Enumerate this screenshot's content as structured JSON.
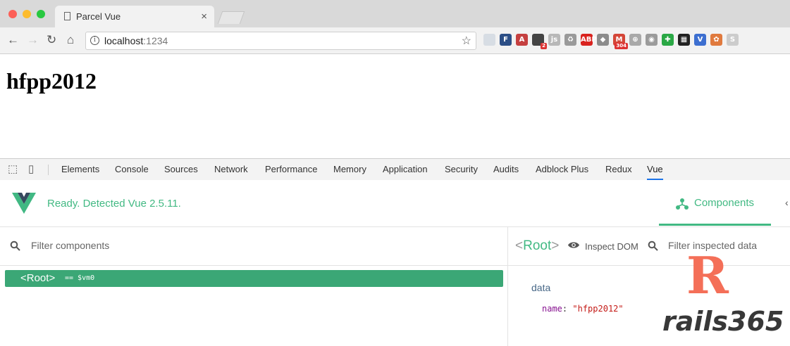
{
  "browser": {
    "tab_title": "Parcel Vue",
    "url_host": "localhost",
    "url_port": ":1234",
    "extensions": [
      {
        "icon": "pen-icon",
        "label": "",
        "bg": "#d7dde4",
        "badge": ""
      },
      {
        "icon": "formatter-f-icon",
        "label": "F",
        "bg": "#2c4f86",
        "badge": ""
      },
      {
        "icon": "a-square-icon",
        "label": "A",
        "bg": "#c54040",
        "badge": ""
      },
      {
        "icon": "extension-badge-icon",
        "label": "",
        "bg": "#444444",
        "badge": "2"
      },
      {
        "icon": "js-icon",
        "label": "js",
        "bg": "#b8b8b8",
        "badge": ""
      },
      {
        "icon": "recycle-icon",
        "label": "♻",
        "bg": "#9a9a9a",
        "badge": ""
      },
      {
        "icon": "adblock-plus-icon",
        "label": "ABP",
        "bg": "#d9231f",
        "badge": ""
      },
      {
        "icon": "diamond-icon",
        "label": "◆",
        "bg": "#8c8c8c",
        "badge": ""
      },
      {
        "icon": "gmail-icon",
        "label": "M",
        "bg": "#d44638",
        "badge": "304"
      },
      {
        "icon": "globe-icon",
        "label": "⊕",
        "bg": "#a9a9a9",
        "badge": ""
      },
      {
        "icon": "film-icon",
        "label": "◉",
        "bg": "#9b9b9b",
        "badge": ""
      },
      {
        "icon": "shield-icon",
        "label": "✚",
        "bg": "#2aa845",
        "badge": ""
      },
      {
        "icon": "qr-code-icon",
        "label": "▦",
        "bg": "#222222",
        "badge": ""
      },
      {
        "icon": "vue-devtools-icon",
        "label": "V",
        "bg": "#3d6fd0",
        "badge": ""
      },
      {
        "icon": "flower-icon",
        "label": "✿",
        "bg": "#e07a3e",
        "badge": ""
      },
      {
        "icon": "s-icon",
        "label": "S",
        "bg": "#cccccc",
        "badge": ""
      }
    ]
  },
  "page": {
    "heading": "hfpp2012"
  },
  "devtools": {
    "tabs": [
      "Elements",
      "Console",
      "Sources",
      "Network",
      "Performance",
      "Memory",
      "Application",
      "Security",
      "Audits",
      "Adblock Plus",
      "Redux",
      "Vue"
    ],
    "active_tab": "Vue",
    "accent": "#1a73e8"
  },
  "vue": {
    "status": "Ready. Detected Vue 2.5.11.",
    "components_tab": "Components",
    "filter_placeholder": "Filter components",
    "root_label": "<Root>",
    "root_suffix": "== $vm0",
    "inspector": {
      "root_open": "<",
      "root_name": "Root",
      "root_close": ">",
      "inspect_dom": "Inspect DOM",
      "filter_placeholder": "Filter inspected data",
      "section": "data",
      "prop_key": "name",
      "prop_colon": ":",
      "prop_value": "\"hfpp2012\""
    },
    "accent": "#42b983"
  },
  "watermark": {
    "letter": "R",
    "text": "rails365"
  }
}
